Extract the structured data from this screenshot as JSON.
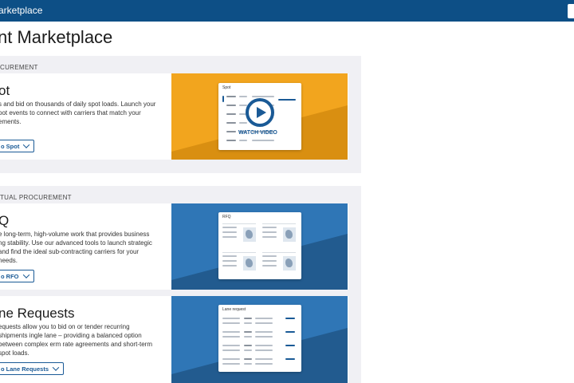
{
  "header": {
    "brand": "arketplace"
  },
  "page": {
    "title": "nt Marketplace"
  },
  "sections": [
    {
      "label": "CUREMENT",
      "cards": [
        {
          "title": "ot",
          "desc": "s and bid on thousands of daily spot loads. Launch your pot events to connect with carriers that match your ements.",
          "button": "o Spot",
          "media": {
            "mock_title": "Spot",
            "overlay": "WATCH VIDEO"
          }
        }
      ]
    },
    {
      "label": "TUAL PROCUREMENT",
      "cards": [
        {
          "title": "Q",
          "desc": "e long-term, high-volume work that provides business ng stability. Use our advanced tools to launch strategic and find the ideal sub-contracting carriers for your needs.",
          "button": "o RFO",
          "media": {
            "mock_title": "RFQ"
          }
        },
        {
          "title": "ne Requests",
          "desc": "equests allow you to bid on or tender recurring shipments ingle lane – providing a balanced option between complex erm rate agreements and short-term spot loads.",
          "button": "o Lane Requests",
          "media": {
            "mock_title": "Lane request"
          }
        }
      ]
    }
  ],
  "colors": {
    "header": "#0d4f86",
    "orange": "#f2a51e",
    "blue": "#2f76b6",
    "accent": "#1a5a96"
  }
}
